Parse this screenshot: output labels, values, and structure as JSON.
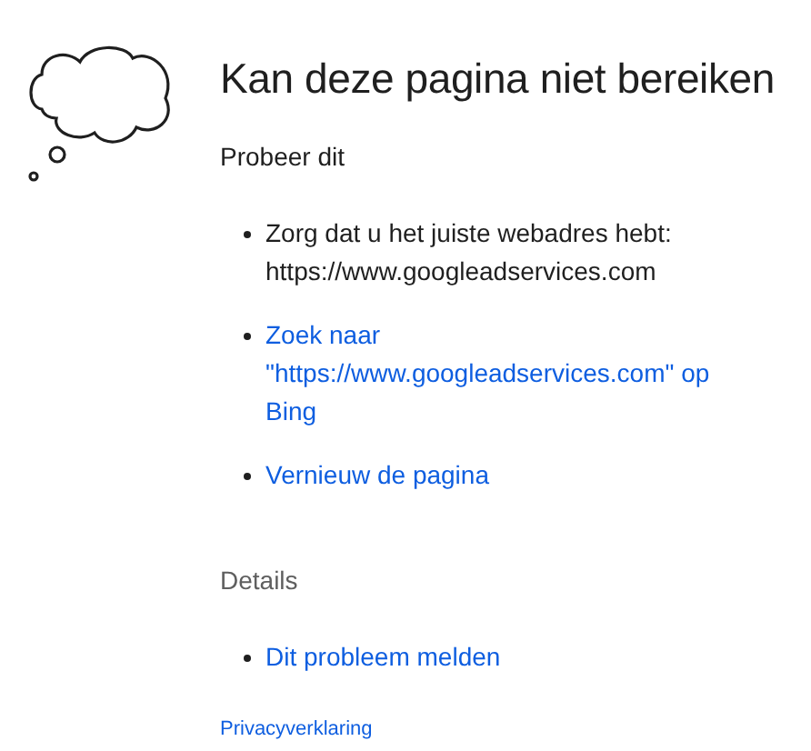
{
  "title": "Kan deze pagina niet bereiken",
  "subtitle": "Probeer dit",
  "suggestions": [
    {
      "kind": "text",
      "text": "Zorg dat u het juiste webadres hebt: https://www.googleadservices.com"
    },
    {
      "kind": "link",
      "text": "Zoek naar \"https://www.googleadservices.com\" op Bing"
    },
    {
      "kind": "link",
      "text": "Vernieuw de pagina"
    }
  ],
  "details_heading": "Details",
  "details": [
    {
      "kind": "link",
      "text": "Dit probleem melden"
    }
  ],
  "footer_link": "Privacyverklaring"
}
